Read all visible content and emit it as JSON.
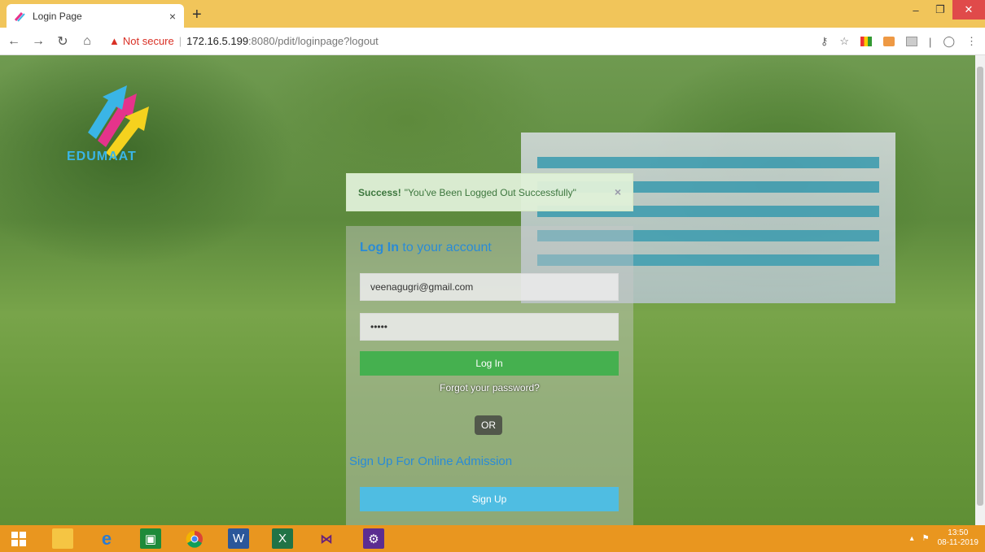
{
  "browser": {
    "tab_title": "Login Page",
    "tab_close": "×",
    "new_tab": "+",
    "win_min": "–",
    "win_max": "❐",
    "win_close": "✕",
    "security_label": "Not secure",
    "url_host": "172.16.5.199",
    "url_rest": ":8080/pdit/loginpage?logout"
  },
  "logo": {
    "text": "EDUMAAT"
  },
  "alert": {
    "strong": "Success!",
    "message": "\"You've Been Logged Out Successfully\"",
    "close": "×"
  },
  "login": {
    "title_bold": "Log In",
    "title_rest": " to your account",
    "email_value": "veenagugri@gmail.com",
    "password_value": "•••••",
    "login_button": "Log In",
    "forgot": "Forgot your password?",
    "or": "OR",
    "signup_text": "Sign Up For Online Admission",
    "signup_button": "Sign Up"
  },
  "taskbar": {
    "time": "13:50",
    "date": "08-11-2019"
  },
  "colors": {
    "tabbar": "#f1c55a",
    "login_green": "#45b04f",
    "signup_blue": "#4fbde2",
    "title_blue": "#2a8bd6",
    "taskbar": "#e9961f"
  }
}
